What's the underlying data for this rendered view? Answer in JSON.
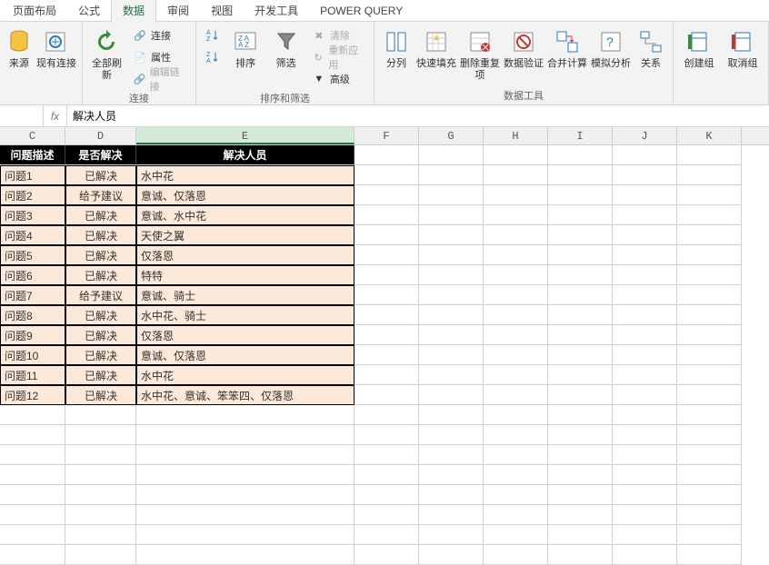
{
  "tabs": {
    "layout": "页面布局",
    "formulas": "公式",
    "data": "数据",
    "review": "审阅",
    "view": "视图",
    "developer": "开发工具",
    "pq": "POWER QUERY"
  },
  "ribbon": {
    "source": "来源",
    "existing": "现有连接",
    "refresh": "全部刷新",
    "connections": "连接",
    "properties": "属性",
    "editlinks": "编辑链接",
    "group_conn": "连接",
    "sort_az": "↓",
    "sort_za": "↓",
    "sort": "排序",
    "filter": "筛选",
    "clear": "清除",
    "reapply": "重新应用",
    "advanced": "高级",
    "group_sort": "排序和筛选",
    "texttocols": "分列",
    "flashfill": "快速填充",
    "removedup": "删除重复项",
    "datavalid": "数据验证",
    "consolidate": "合并计算",
    "whatif": "模拟分析",
    "relations": "关系",
    "group_tools": "数据工具",
    "groupbtn": "创建组",
    "ungroup": "取消组"
  },
  "formula": {
    "value": "解决人员"
  },
  "cols": {
    "C": "C",
    "D": "D",
    "E": "E",
    "F": "F",
    "G": "G",
    "H": "H",
    "I": "I",
    "J": "J",
    "K": "K"
  },
  "headers": {
    "C": "问题描述",
    "D": "是否解决",
    "E": "解决人员"
  },
  "rows": [
    {
      "c": "问题1",
      "d": "已解决",
      "e": "水中花"
    },
    {
      "c": "问题2",
      "d": "给予建议",
      "e": "意诚、仅落恩"
    },
    {
      "c": "问题3",
      "d": "已解决",
      "e": "意诚、水中花"
    },
    {
      "c": "问题4",
      "d": "已解决",
      "e": "天使之翼"
    },
    {
      "c": "问题5",
      "d": "已解决",
      "e": "仅落恩"
    },
    {
      "c": "问题6",
      "d": "已解决",
      "e": "特特"
    },
    {
      "c": "问题7",
      "d": "给予建议",
      "e": "意诚、骑士"
    },
    {
      "c": "问题8",
      "d": "已解决",
      "e": "水中花、骑士"
    },
    {
      "c": "问题9",
      "d": "已解决",
      "e": "仅落恩"
    },
    {
      "c": "问题10",
      "d": "已解决",
      "e": "意诚、仅落恩"
    },
    {
      "c": "问题11",
      "d": "已解决",
      "e": "水中花"
    },
    {
      "c": "问题12",
      "d": "已解决",
      "e": "水中花、意诚、笨笨四、仅落恩"
    }
  ]
}
